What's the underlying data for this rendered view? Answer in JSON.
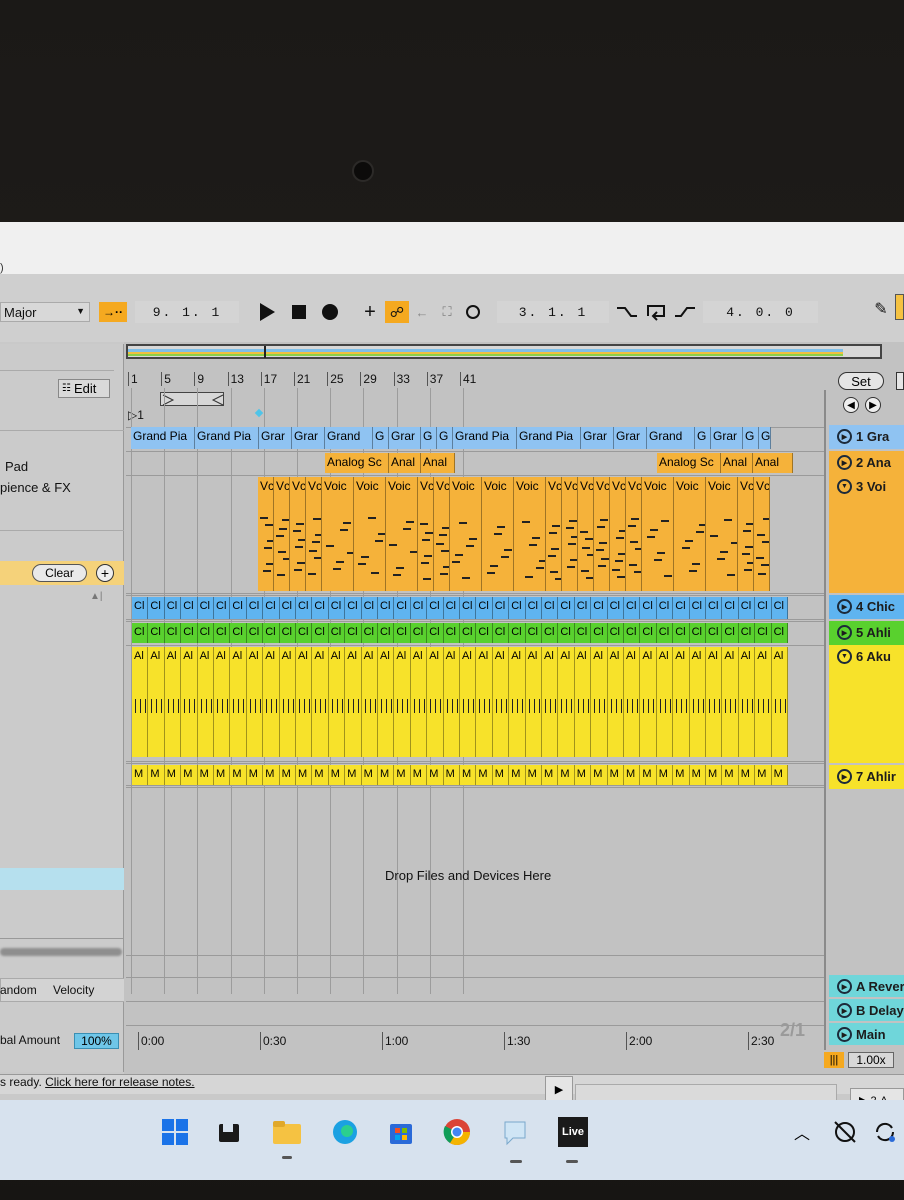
{
  "transport": {
    "scale": "Major",
    "arrangement_position": "9. 1. 1",
    "loop_start": "3. 1. 1",
    "loop_length": "4. 0. 0",
    "edit_label": "Edit",
    "set_label": "Set"
  },
  "browser": {
    "items": [
      "Pad",
      "pience & FX"
    ],
    "clear_label": "Clear",
    "random_label": "andom",
    "velocity_label": "Velocity",
    "global_amount_label": "bal Amount",
    "global_amount_value": "100%"
  },
  "ruler": {
    "bars": [
      "1",
      "5",
      "9",
      "13",
      "17",
      "21",
      "25",
      "29",
      "33",
      "37",
      "41"
    ],
    "times": [
      "0:00",
      "0:30",
      "1:00",
      "1:30",
      "2:00",
      "2:30"
    ],
    "locator": "1"
  },
  "tracks": [
    {
      "name": "1 Gra",
      "color": "#8fc3f2",
      "clip_names": [
        "Grand Pia",
        "Grand Pia",
        "Grar",
        "Grar",
        "Grand",
        "G",
        "Grar",
        "G",
        "G",
        "Grand Pia",
        "Grand Pia",
        "Grar",
        "Grar",
        "Grand",
        "G",
        "Grar",
        "G",
        "G"
      ]
    },
    {
      "name": "2 Ana",
      "color": "#f5b23a",
      "clip_names": [
        "Analog Sc",
        "Anal",
        "Anal",
        "Analog Sc",
        "Anal",
        "Anal"
      ]
    },
    {
      "name": "3 Voi",
      "color": "#f5b23a",
      "clip_names": [
        "Vc",
        "Vc",
        "Vc",
        "Vc",
        "Voic",
        "Voic",
        "Voic",
        "Vc",
        "Vc",
        "Voic",
        "Voic",
        "Voic",
        "Vc",
        "Vc",
        "Vc",
        "Vc",
        "Vc",
        "Vc",
        "Voic",
        "Voic",
        "Voic",
        "Vc",
        "Vc"
      ]
    },
    {
      "name": "4 Chic",
      "color": "#5fb4f0",
      "clip_label": "Cl"
    },
    {
      "name": "5 Ahli",
      "color": "#59d12e",
      "clip_label": "Cl"
    },
    {
      "name": "6 Aku",
      "color": "#f7e22a",
      "clip_label": "Al"
    },
    {
      "name": "7 Ahlir",
      "color": "#f7e22a",
      "clip_label": "M"
    }
  ],
  "returns": [
    {
      "name": "A Rever",
      "color": "#6fd6da"
    },
    {
      "name": "B Delay",
      "color": "#6fd6da"
    },
    {
      "name": "Main",
      "color": "#6fd6da"
    }
  ],
  "drop_hint": "Drop Files and Devices Here",
  "grid_quantization": "2/1",
  "tempo_scale": "1.00x",
  "status_bar": {
    "prefix": "s ready. ",
    "link": "Click here for release notes."
  },
  "taskbar": [
    "windows-start",
    "file-explorer",
    "edge",
    "store",
    "chrome",
    "messaging",
    "ableton-live"
  ],
  "live_label": "Live"
}
